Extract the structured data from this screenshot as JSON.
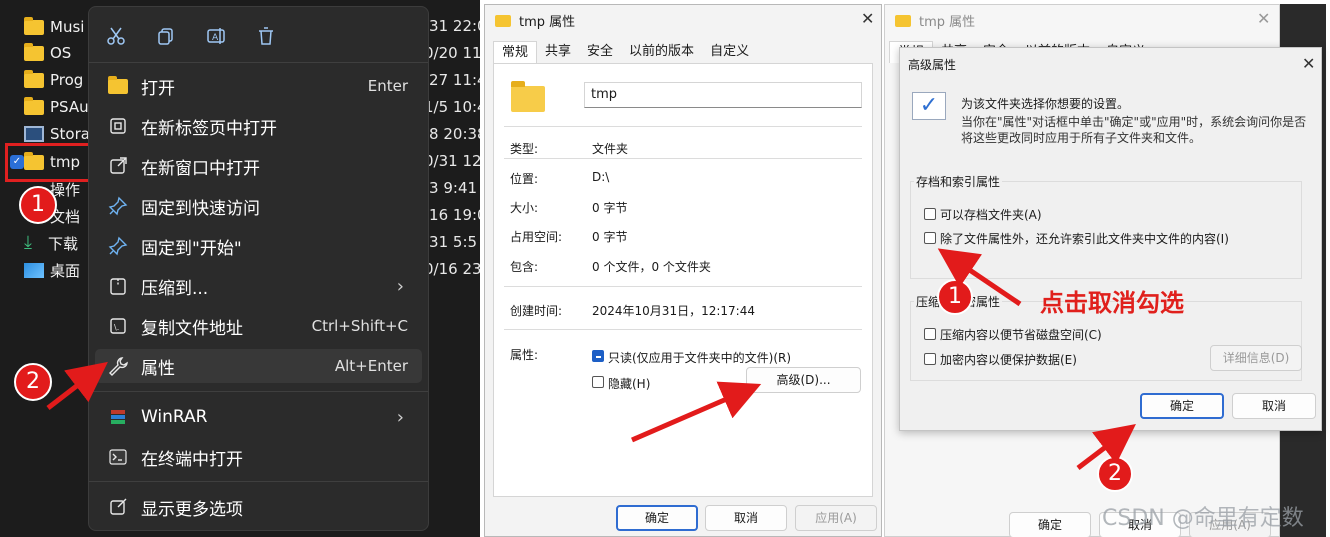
{
  "colors": {
    "accent": "#2f6cd1",
    "annotation": "#e21b1b",
    "menu_bg": "#2b2b2b",
    "folder": "#f5c431"
  },
  "explorer": {
    "tree": [
      {
        "label": "Musi",
        "icon": "folder-icon"
      },
      {
        "label": "OS",
        "icon": "folder-icon"
      },
      {
        "label": "Prog",
        "icon": "folder-icon"
      },
      {
        "label": "PSAu",
        "icon": "folder-icon"
      },
      {
        "label": "Stora",
        "icon": "drive-icon"
      },
      {
        "label": "tmp",
        "icon": "folder-icon"
      },
      {
        "label": "操作",
        "icon": "folder-icon"
      },
      {
        "label": "文档",
        "icon": "document-icon"
      },
      {
        "label": "下载",
        "icon": "download-icon"
      },
      {
        "label": "桌面",
        "icon": "desktop-icon"
      }
    ],
    "dates": [
      "/31 22:0",
      "0/20 11:",
      "/27 11:4",
      "1/5 10:4",
      "/8 20:38",
      "0/31 12",
      "/3 9:41",
      "/16 19:0",
      "/31 5:5",
      "0/16 23"
    ]
  },
  "context_menu": {
    "toolbar": [
      {
        "icon": "cut-icon"
      },
      {
        "icon": "copy-icon"
      },
      {
        "icon": "rename-icon"
      },
      {
        "icon": "delete-icon"
      }
    ],
    "items": [
      {
        "label": "打开",
        "accel": "Enter",
        "icon": "folder-open-icon"
      },
      {
        "label": "在新标签页中打开",
        "accel": "",
        "icon": "new-tab-icon"
      },
      {
        "label": "在新窗口中打开",
        "accel": "",
        "icon": "new-window-icon"
      },
      {
        "label": "固定到快速访问",
        "accel": "",
        "icon": "pin-icon"
      },
      {
        "label": "固定到\"开始\"",
        "accel": "",
        "icon": "pin-icon"
      },
      {
        "label": "压缩到...",
        "accel": "",
        "icon": "zip-icon"
      },
      {
        "label": "复制文件地址",
        "accel": "Ctrl+Shift+C",
        "icon": "copy-path-icon"
      },
      {
        "label": "属性",
        "accel": "Alt+Enter",
        "icon": "wrench-icon"
      },
      {
        "label": "WinRAR",
        "accel": "",
        "icon": "winrar-icon"
      },
      {
        "label": "在终端中打开",
        "accel": "",
        "icon": "terminal-icon"
      },
      {
        "label": "显示更多选项",
        "accel": "",
        "icon": "more-options-icon"
      }
    ]
  },
  "steps": {
    "one": "1",
    "two": "2"
  },
  "props_dialog": {
    "title": "tmp 属性",
    "tabs": [
      "常规",
      "共享",
      "安全",
      "以前的版本",
      "自定义"
    ],
    "name": "tmp",
    "rows": [
      {
        "key": "类型:",
        "value": "文件夹"
      },
      {
        "key": "位置:",
        "value": "D:\\"
      },
      {
        "key": "大小:",
        "value": "0 字节"
      },
      {
        "key": "占用空间:",
        "value": "0 字节"
      },
      {
        "key": "包含:",
        "value": "0 个文件，0 个文件夹"
      }
    ],
    "created_key": "创建时间:",
    "created_value": "2024年10月31日，12:17:44",
    "attrs_key": "属性:",
    "readonly_label": "只读(仅应用于文件夹中的文件)(R)",
    "hidden_label": "隐藏(H)",
    "advanced_button": "高级(D)...",
    "ok": "确定",
    "cancel": "取消",
    "apply": "应用(A)"
  },
  "bg_dialog": {
    "title": "tmp 属性",
    "tabs": [
      "常规",
      "共享",
      "安全",
      "以前的版本",
      "自定义"
    ],
    "ok": "确定",
    "cancel": "取消",
    "apply": "应用(A)"
  },
  "adv_dialog": {
    "title": "高级属性",
    "intro": "为该文件夹选择你想要的设置。",
    "desc": "当你在\"属性\"对话框中单击\"确定\"或\"应用\"时，系统会询问你是否将这些更改同时应用于所有子文件夹和文件。",
    "group1_title": "存档和索引属性",
    "archive_label": "可以存档文件夹(A)",
    "index_label": "除了文件属性外，还允许索引此文件夹中文件的内容(I)",
    "group2_title": "压缩或加密属性",
    "compress_label": "压缩内容以便节省磁盘空间(C)",
    "encrypt_label": "加密内容以便保护数据(E)",
    "details_button": "详细信息(D)",
    "ok": "确定",
    "cancel": "取消"
  },
  "annotation_text": "点击取消勾选",
  "watermark": "CSDN @命里有定数"
}
